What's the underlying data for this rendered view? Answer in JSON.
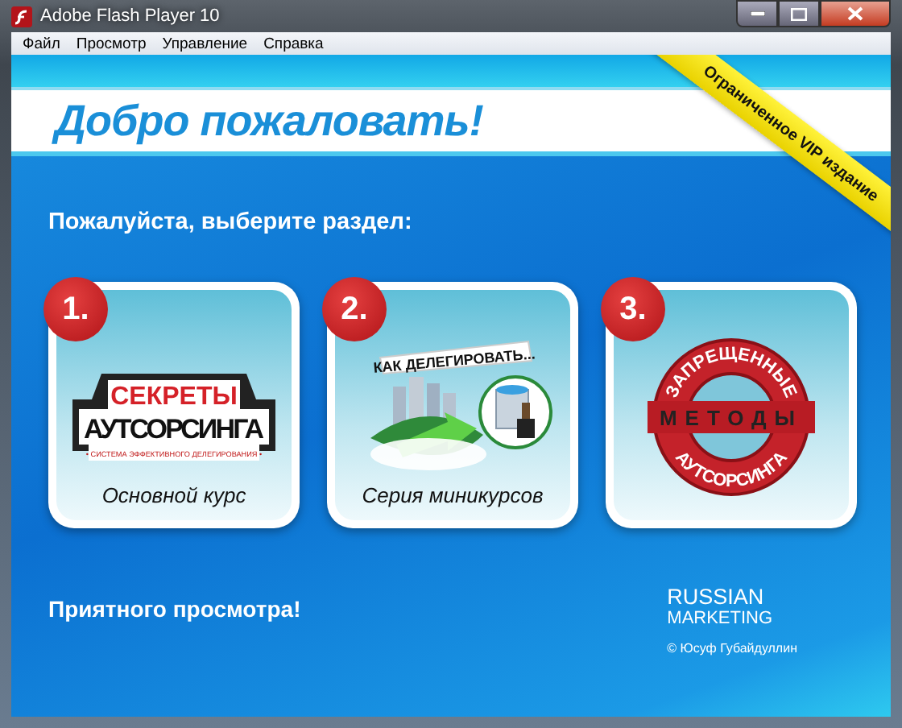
{
  "window": {
    "title": "Adobe Flash Player 10"
  },
  "menu": [
    "Файл",
    "Просмотр",
    "Управление",
    "Справка"
  ],
  "header": {
    "title": "Добро пожаловать!",
    "ribbon": "Ограниченное VIP издание"
  },
  "prompt": "Пожалуйста, выберите раздел:",
  "cards": [
    {
      "number": "1.",
      "label": "Основной курс",
      "logo": {
        "kind": "banner",
        "lines": [
          "СЕКРЕТЫ",
          "АУТСОРСИНГА",
          "• СИСТЕМА ЭФФЕКТИВНОГО ДЕЛЕГИРОВАНИЯ •"
        ]
      }
    },
    {
      "number": "2.",
      "label": "Серия миникурсов",
      "logo": {
        "kind": "illustration",
        "lines": [
          "КАК ДЕЛЕГИРОВАТЬ..."
        ]
      }
    },
    {
      "number": "3.",
      "logo": {
        "kind": "seal",
        "lines": [
          "ЗАПРЕЩЕННЫЕ",
          "МЕТОДЫ",
          "АУТСОРСИНГА"
        ]
      }
    }
  ],
  "footer": {
    "greeting": "Приятного просмотра!",
    "brand": [
      "RUSSIAN",
      "MARKETING"
    ],
    "copyright": "© Юсуф Губайдуллин"
  }
}
